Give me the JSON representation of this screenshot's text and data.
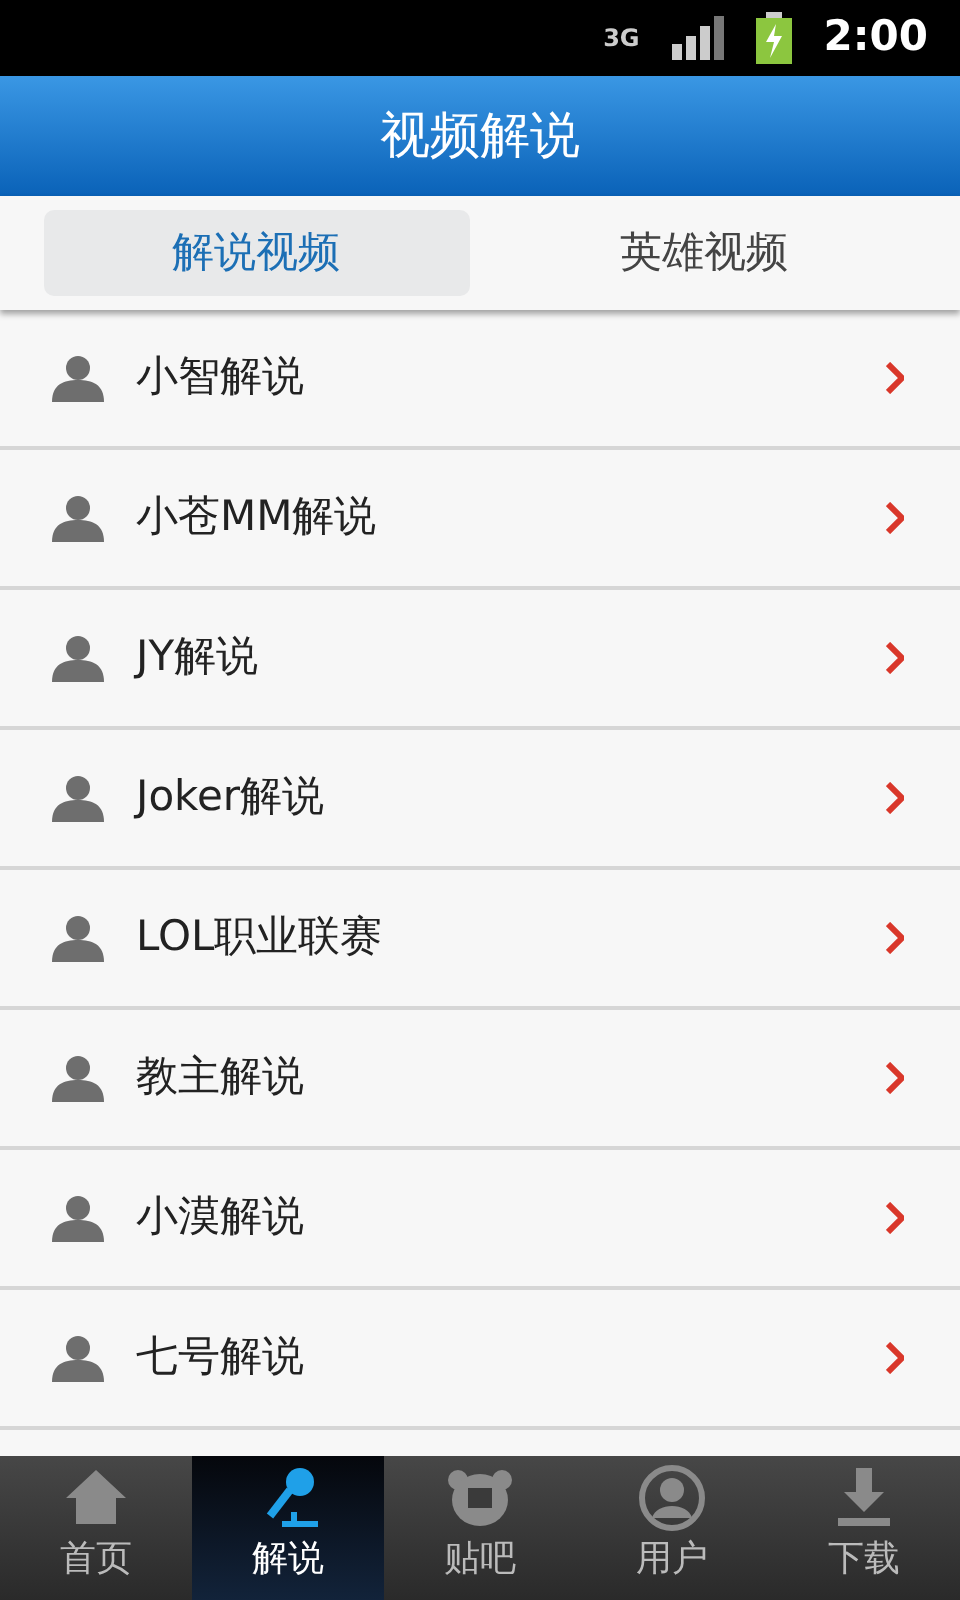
{
  "status_bar": {
    "time": "2:00",
    "network": "3G"
  },
  "header": {
    "title": "视频解说"
  },
  "tabs": [
    {
      "label": "解说视频",
      "selected": true
    },
    {
      "label": "英雄视频",
      "selected": false
    }
  ],
  "list": [
    {
      "name": "小智解说"
    },
    {
      "name": "小苍MM解说"
    },
    {
      "name": "JY解说"
    },
    {
      "name": "Joker解说"
    },
    {
      "name": "LOL职业联赛"
    },
    {
      "name": "教主解说"
    },
    {
      "name": "小漠解说"
    },
    {
      "name": "七号解说"
    }
  ],
  "bottom_nav": [
    {
      "label": "首页",
      "kind": "home",
      "selected": false
    },
    {
      "label": "解说",
      "kind": "mic",
      "selected": true
    },
    {
      "label": "贴吧",
      "kind": "bear",
      "selected": false
    },
    {
      "label": "用户",
      "kind": "user",
      "selected": false
    },
    {
      "label": "下载",
      "kind": "download",
      "selected": false
    }
  ]
}
